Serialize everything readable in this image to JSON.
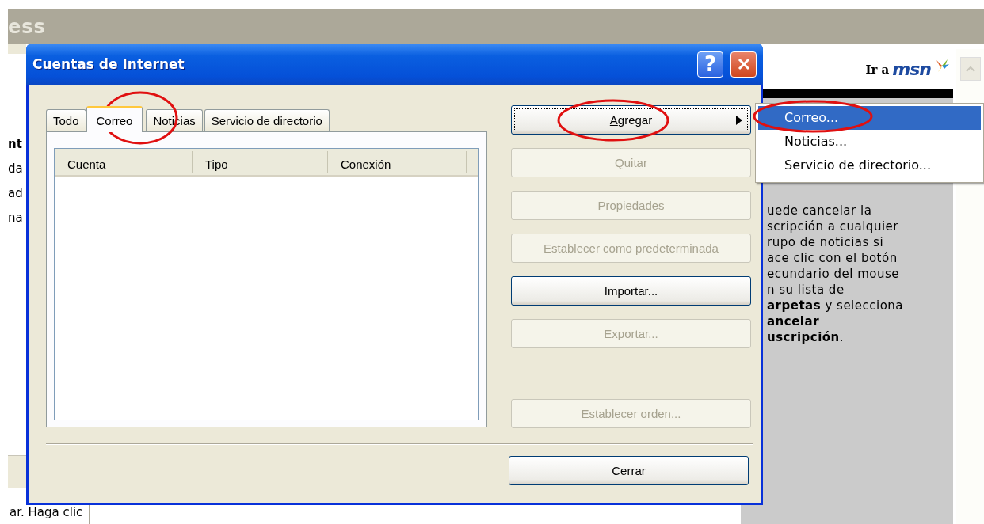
{
  "background_window": {
    "title": "ess",
    "left_texts": [
      {
        "text": "nt",
        "bold": true
      },
      {
        "text": "da",
        "bold": false
      },
      {
        "text": "ad",
        "bold": false
      },
      {
        "text": "na",
        "bold": false
      }
    ],
    "status_text": "ar. Haga clic",
    "side_panel": {
      "link_text": "Ir a",
      "logo_text": "msn",
      "paragraph_lines": [
        "uede cancelar la",
        "scripción a cualquier",
        "rupo de noticias si",
        "ace clic con el botón",
        "ecundario del mouse",
        "n su lista de",
        "**arpetas** y selecciona",
        "**ancelar**",
        "**uscripción**."
      ]
    }
  },
  "dialog": {
    "title": "Cuentas de Internet",
    "title_buttons": [
      {
        "kind": "help",
        "label": "?"
      },
      {
        "kind": "close"
      }
    ],
    "tabs": [
      {
        "label": "Todo",
        "selected": false
      },
      {
        "label": "Correo",
        "selected": true
      },
      {
        "label": "Noticias",
        "selected": false
      },
      {
        "label": "Servicio de directorio",
        "selected": false
      }
    ],
    "list": {
      "columns": [
        "Cuenta",
        "Tipo",
        "Conexión"
      ]
    },
    "buttons": [
      {
        "label": "Agregar",
        "kind": "submenu",
        "disabled": false,
        "focused": true,
        "mnemonic_first": true
      },
      {
        "label": "Quitar",
        "kind": "plain",
        "disabled": true,
        "focused": false,
        "mnemonic_first": false
      },
      {
        "label": "Propiedades",
        "kind": "plain",
        "disabled": true,
        "focused": false,
        "mnemonic_first": false
      },
      {
        "label": "Establecer como predeterminada",
        "kind": "plain",
        "disabled": true,
        "focused": false,
        "mnemonic_first": false
      },
      {
        "label": "Importar...",
        "kind": "plain",
        "disabled": false,
        "focused": false,
        "mnemonic_first": false
      },
      {
        "label": "Exportar...",
        "kind": "plain",
        "disabled": true,
        "focused": false,
        "mnemonic_first": false
      },
      {
        "label": "Establecer orden...",
        "kind": "spaced",
        "disabled": true,
        "focused": false,
        "mnemonic_first": false
      }
    ],
    "close_button": {
      "label": "Cerrar",
      "disabled": false
    }
  },
  "menu": {
    "items": [
      {
        "label": "Correo...",
        "selected": true
      },
      {
        "label": "Noticias...",
        "selected": false
      },
      {
        "label": "Servicio de directorio...",
        "selected": false
      }
    ]
  }
}
